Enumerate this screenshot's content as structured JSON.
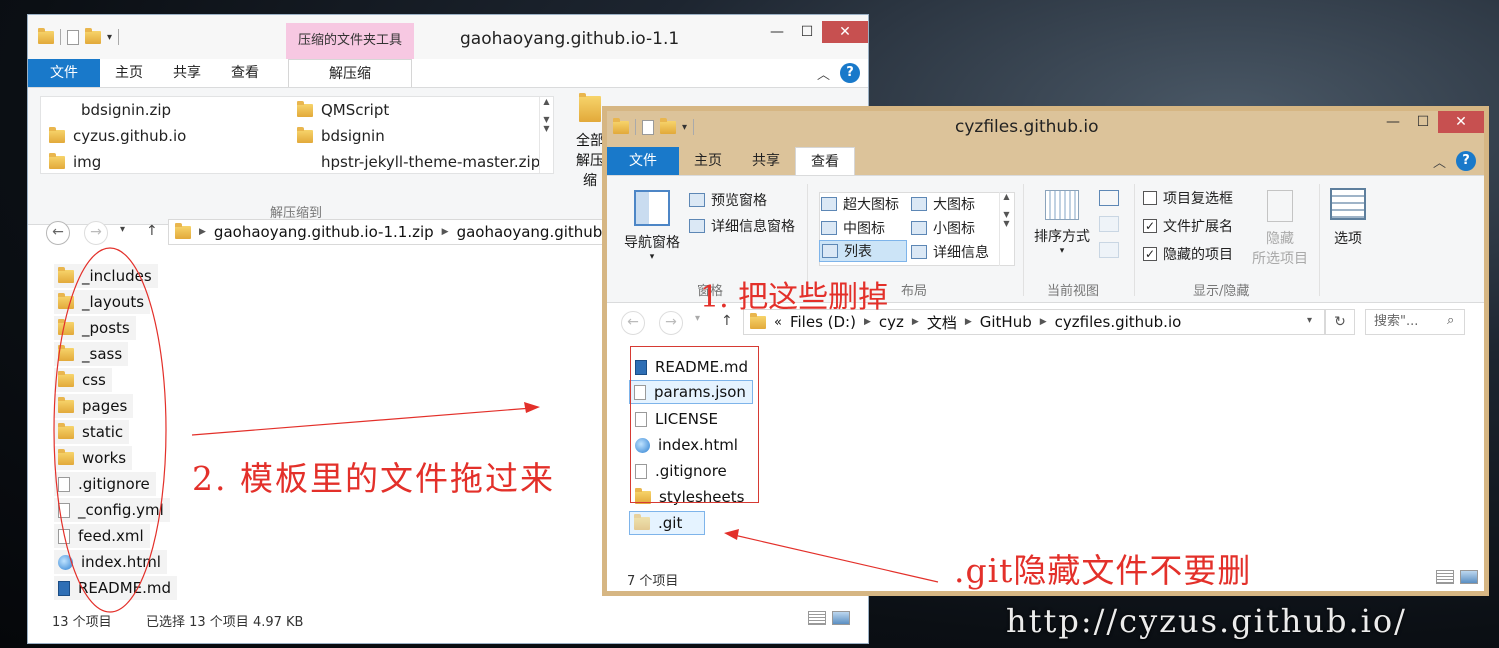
{
  "window1": {
    "title": "gaohaoyang.github.io-1.1",
    "context_tab": "压缩的文件夹工具",
    "tabs": [
      "文件",
      "主页",
      "共享",
      "查看",
      "解压缩"
    ],
    "extract_items": [
      "bdsignin.zip",
      "cyzus.github.io",
      "img",
      "QMScript",
      "bdsignin",
      "hpstr-jekyll-theme-master.zip"
    ],
    "extract_group_label": "解压缩到",
    "extract_all_label_1": "全部",
    "extract_all_label_2": "解压缩",
    "address": [
      "gaohaoyang.github.io-1.1.zip",
      "gaohaoyang.github.io"
    ],
    "files": [
      "_includes",
      "_layouts",
      "_posts",
      "_sass",
      "css",
      "pages",
      "static",
      "works",
      ".gitignore",
      "_config.yml",
      "feed.xml",
      "index.html",
      "README.md"
    ],
    "status_count": "13 个项目",
    "status_selected": "已选择 13 个项目 4.97 KB"
  },
  "window2": {
    "title": "cyzfiles.github.io",
    "tabs": [
      "文件",
      "主页",
      "共享",
      "查看"
    ],
    "ribbon": {
      "nav_pane": "导航窗格",
      "preview_pane": "预览窗格",
      "details_pane": "详细信息窗格",
      "panes_group": "窗格",
      "layouts": [
        "超大图标",
        "大图标",
        "中图标",
        "小图标",
        "列表",
        "详细信息"
      ],
      "layout_group": "布局",
      "sort_by": "排序方式",
      "current_view_group": "当前视图",
      "checkboxes": [
        {
          "label": "项目复选框",
          "checked": false
        },
        {
          "label": "文件扩展名",
          "checked": true
        },
        {
          "label": "隐藏的项目",
          "checked": true
        }
      ],
      "hide_1": "隐藏",
      "hide_2": "所选项目",
      "show_hide_group": "显示/隐藏",
      "options": "选项"
    },
    "address": [
      "Files (D:)",
      "cyz",
      "文档",
      "GitHub",
      "cyzfiles.github.io"
    ],
    "search_placeholder": "搜索\"...",
    "files": [
      "README.md",
      "params.json",
      "LICENSE",
      "index.html",
      ".gitignore",
      "stylesheets",
      ".git"
    ],
    "status_count": "7 个项目"
  },
  "annotations": {
    "delete_these": "1. 把这些删掉",
    "drag_template": "2. 模板里的文件拖过来",
    "keep_git": ".git隐藏文件不要删"
  },
  "watermark": "http://cyzus.github.io/",
  "colors": {
    "accent": "#1979ca",
    "annotation": "#e3302a",
    "window2_frame": "#d6b683"
  }
}
